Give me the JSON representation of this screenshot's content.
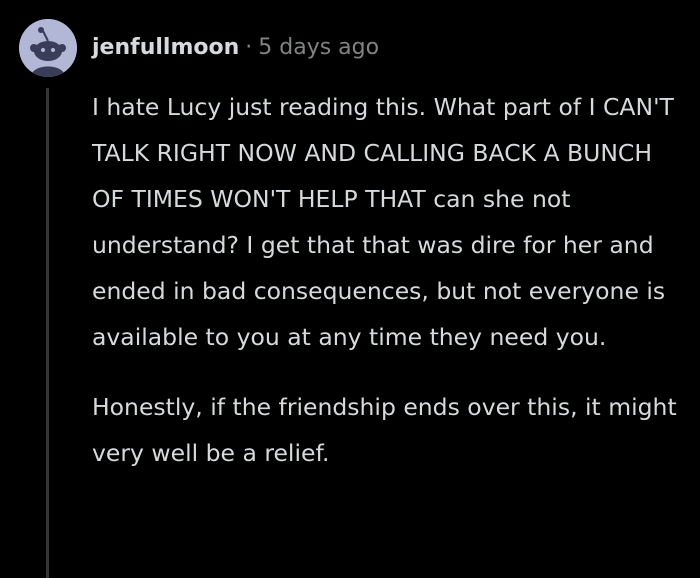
{
  "comment": {
    "author": "jenfullmoon",
    "separator": "·",
    "timestamp": "5 days ago",
    "avatar_icon": "snoo-avatar-icon",
    "paragraphs": [
      "I hate Lucy just reading this. What part of I CAN'T TALK RIGHT NOW AND CALLING BACK A BUNCH OF TIMES WON'T HELP THAT can she not understand? I get that that was dire for her and ended in bad consequences, but not everyone is available to you at any time they need you.",
      "Honestly, if the friendship ends over this, it might very well be a relief."
    ]
  },
  "colors": {
    "background": "#000000",
    "text": "#d7dadc",
    "meta": "#818384",
    "thread_line": "#343536",
    "avatar_bg": "#b3b7d6",
    "avatar_figure": "#3a3d58"
  }
}
